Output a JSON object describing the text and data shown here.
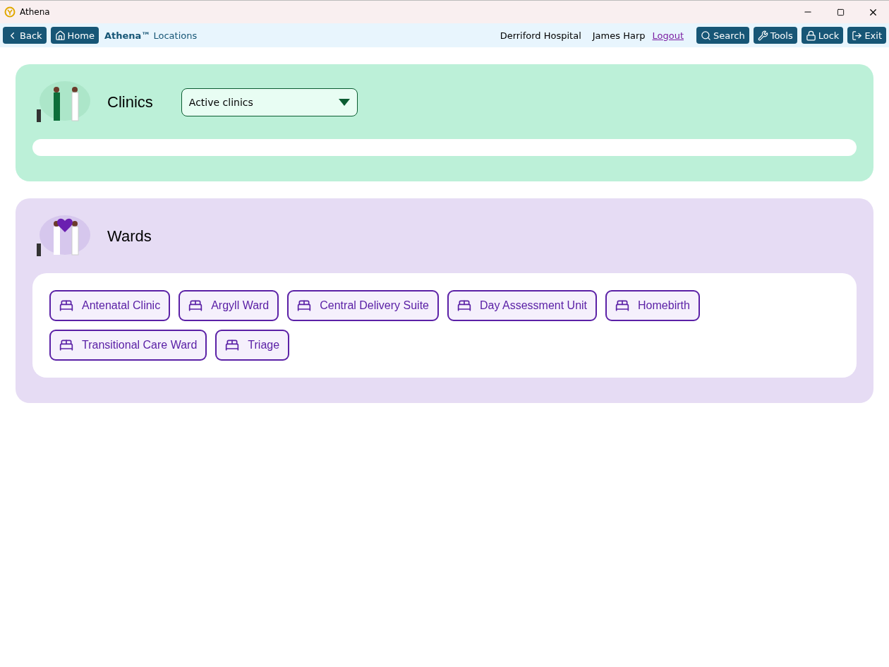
{
  "window": {
    "title": "Athena"
  },
  "nav": {
    "left_buttons": [
      {
        "kind": "back",
        "label": "Back"
      },
      {
        "kind": "home",
        "label": "Home"
      }
    ],
    "title": "**Athena™** Locations",
    "site": "Derriford Hospital",
    "user": "James Harp",
    "logout": "Logout",
    "right_buttons": [
      {
        "kind": "search",
        "label": "Search"
      },
      {
        "kind": "tools",
        "label": "Tools"
      },
      {
        "kind": "lock",
        "label": "Lock"
      },
      {
        "kind": "exit",
        "label": "Exit"
      }
    ]
  },
  "clinics": {
    "title": "Clinics",
    "filter": "Active clinics"
  },
  "wards": {
    "title": "Wards",
    "items": [
      {
        "label": "Antenatal Clinic"
      },
      {
        "label": "Argyll Ward"
      },
      {
        "label": "Central Delivery Suite"
      },
      {
        "label": "Day Assessment Unit"
      },
      {
        "label": "Homebirth"
      },
      {
        "label": "Transitional Care Ward"
      },
      {
        "label": "Triage"
      }
    ]
  }
}
